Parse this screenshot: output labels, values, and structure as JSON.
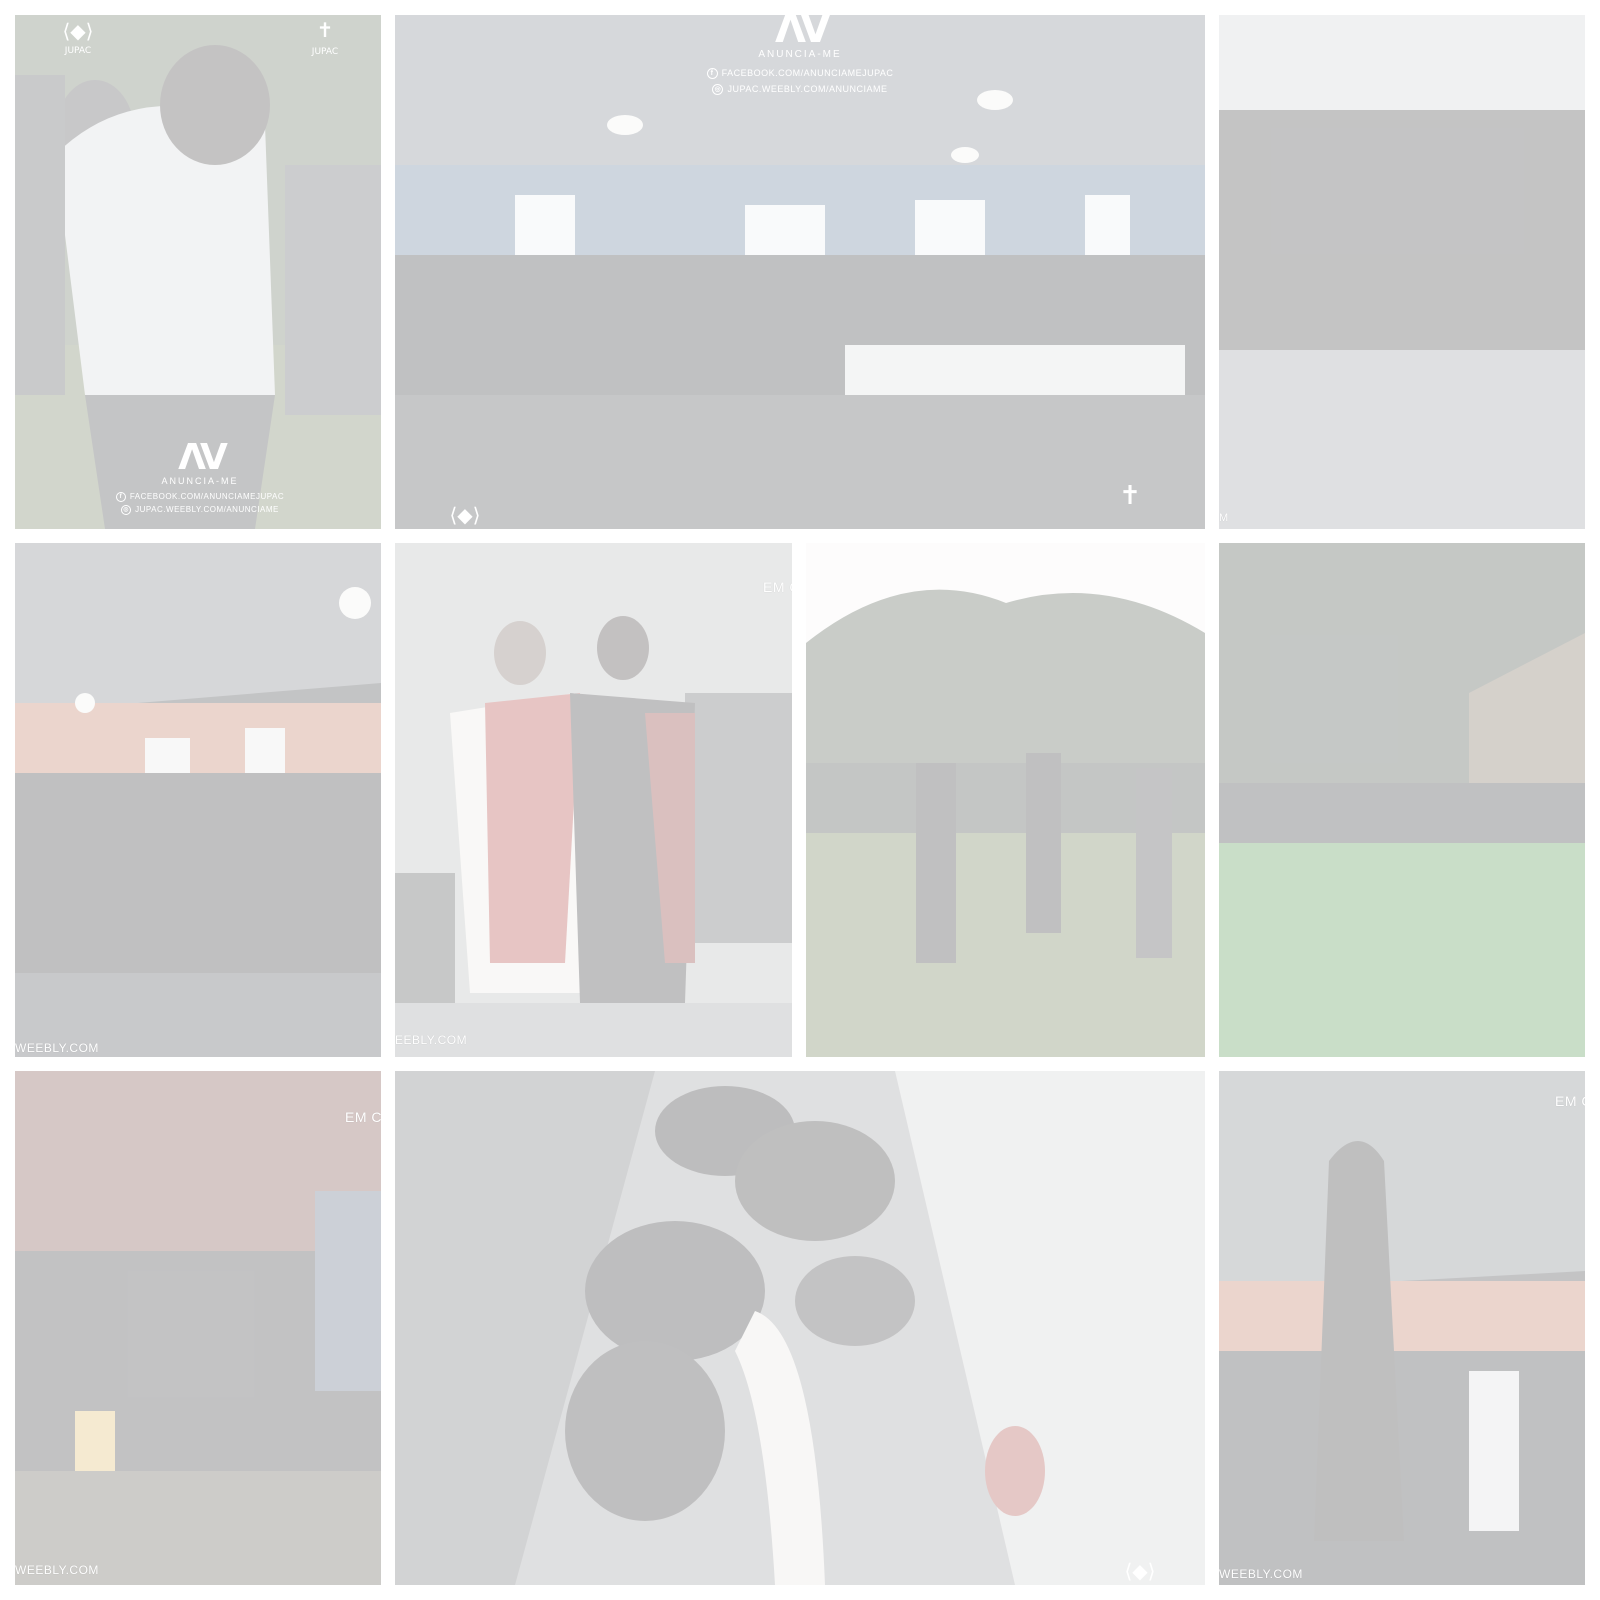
{
  "gallery": {
    "tiles": [
      {
        "name": "photo-embrace",
        "caption": ""
      },
      {
        "name": "photo-hall-audience",
        "caption": ""
      },
      {
        "name": "photo-group-outdoor",
        "caption": ""
      },
      {
        "name": "photo-hall-crowd",
        "caption": ""
      },
      {
        "name": "photo-costumed-pair",
        "caption": ""
      },
      {
        "name": "photo-field-gathering",
        "caption": ""
      },
      {
        "name": "photo-field-group",
        "caption": ""
      },
      {
        "name": "photo-altar",
        "caption": ""
      },
      {
        "name": "photo-prayer",
        "caption": ""
      },
      {
        "name": "photo-statue-hall",
        "caption": ""
      }
    ]
  },
  "watermark": {
    "brand_mark": "ΛV",
    "brand_name": "ANUNCIA-ME",
    "facebook": "FACEBOOK.COM/ANUNCIAMEJUPAC",
    "site": "JUPAC.WEEBLY.COM/ANUNCIAME",
    "site_fragment_1": "M",
    "site_fragment_2": "WEEBLY.COM",
    "site_fragment_3": "EEBLY.COM",
    "em_fragment": "EM C",
    "em_fragment_2": "EM CO",
    "emblem_text": "JUPAC",
    "emblem_text_2": "JUPAC"
  },
  "icons": {
    "facebook": "facebook-icon",
    "globe": "globe-icon",
    "wings": "wings-emblem-icon",
    "cross": "cross-emblem-icon"
  }
}
